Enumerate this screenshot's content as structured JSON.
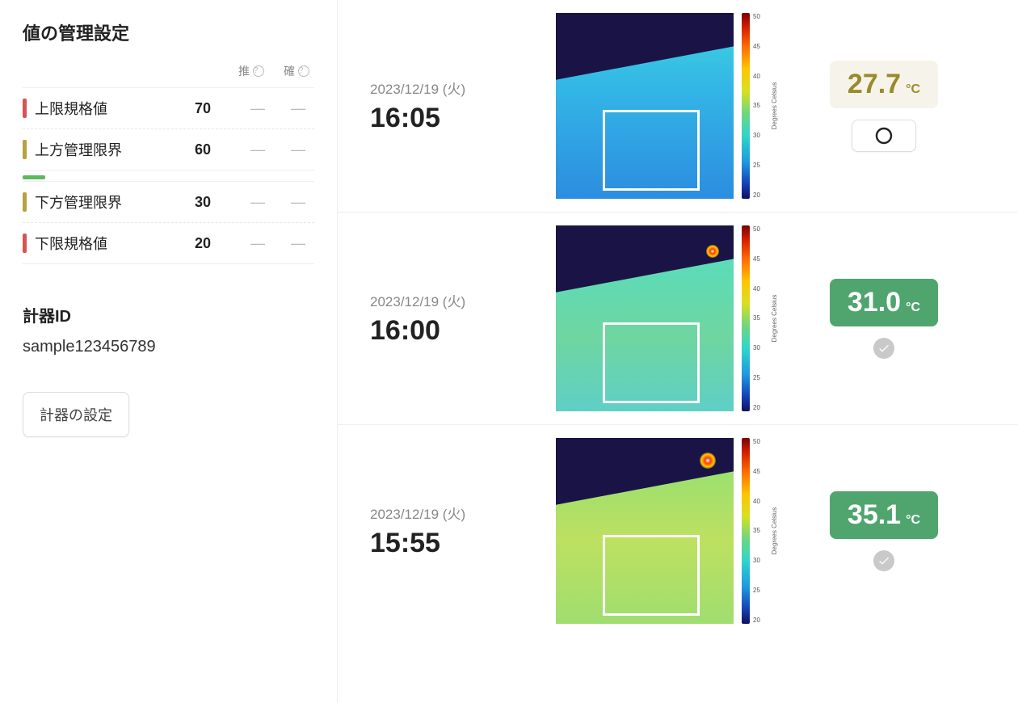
{
  "sidebar": {
    "title": "値の管理設定",
    "col_estimate": "推",
    "col_confirm": "確",
    "rows": [
      {
        "label": "上限規格値",
        "value": "70",
        "color": "c-red"
      },
      {
        "label": "上方管理限界",
        "value": "60",
        "color": "c-olive"
      },
      {
        "label": "下方管理限界",
        "value": "30",
        "color": "c-olive"
      },
      {
        "label": "下限規格値",
        "value": "20",
        "color": "c-red"
      }
    ],
    "dash": "—",
    "instrument_id_title": "計器ID",
    "instrument_id": "sample123456789",
    "settings_button": "計器の設定"
  },
  "scale": {
    "ticks": [
      "50",
      "45",
      "40",
      "35",
      "30",
      "25",
      "20"
    ],
    "label": "Degrees Celsius"
  },
  "entries": [
    {
      "date": "2023/12/19 (火)",
      "time": "16:05",
      "thermo_class": "t-cold",
      "hotspot": false,
      "temp": "27.7",
      "unit": "°C",
      "chip_class": "chip-light",
      "status": "open"
    },
    {
      "date": "2023/12/19 (火)",
      "time": "16:00",
      "thermo_class": "t-mid",
      "hotspot": true,
      "temp": "31.0",
      "unit": "°C",
      "chip_class": "chip-green",
      "status": "checked"
    },
    {
      "date": "2023/12/19 (火)",
      "time": "15:55",
      "thermo_class": "t-warm",
      "hotspot": true,
      "temp": "35.1",
      "unit": "°C",
      "chip_class": "chip-green",
      "status": "checked"
    }
  ]
}
